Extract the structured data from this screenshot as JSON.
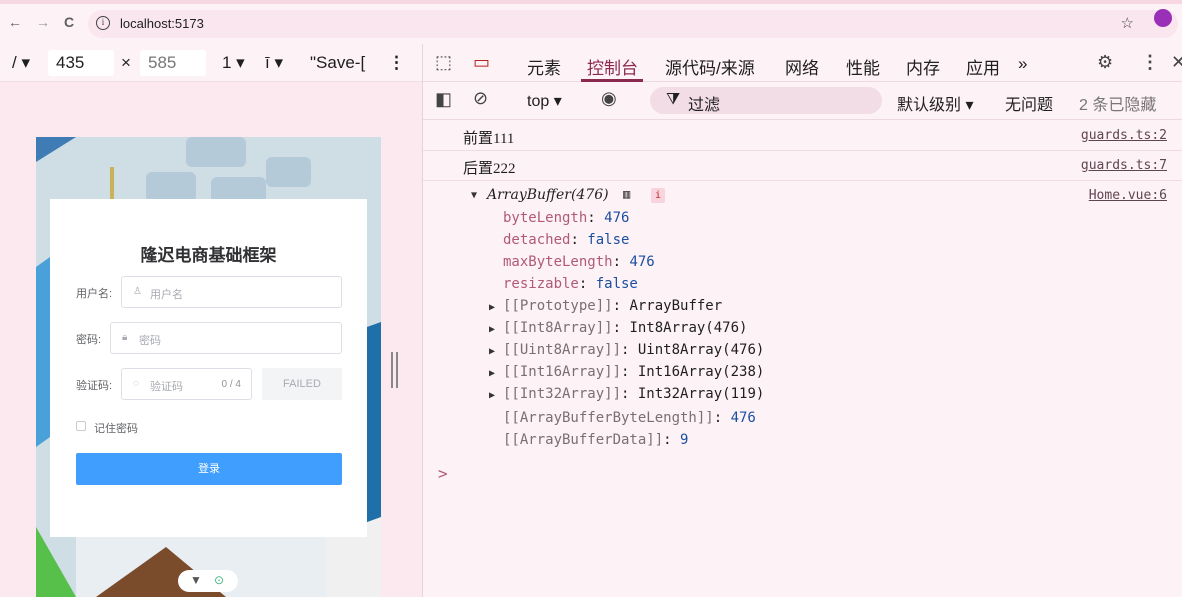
{
  "browser": {
    "url": "localhost:5173",
    "nav": {
      "back": "←",
      "forward": "→",
      "reload": "C"
    }
  },
  "device_toolbar": {
    "device_label": "/ ▾",
    "width": "435",
    "times": "×",
    "height": "585",
    "zoom": "1 ▾",
    "throttle": "ī ▾",
    "save": "\"Save-[",
    "more": "⋮"
  },
  "app": {
    "title": "隆迟电商基础框架",
    "username_label": "用户名:",
    "username_placeholder": "用户名",
    "password_label": "密码:",
    "password_placeholder": "密码",
    "captcha_label": "验证码:",
    "captcha_placeholder": "验证码",
    "captcha_count": "0 / 4",
    "captcha_image_text": "FAILED",
    "remember": "记住密码",
    "login": "登录"
  },
  "devtools": {
    "tabs": [
      "元素",
      "控制台",
      "源代码/来源",
      "网络",
      "性能",
      "内存",
      "应用"
    ],
    "active_tab": "控制台",
    "more_tabs": "»",
    "console_bar": {
      "context": "top ▾",
      "filter": "过滤",
      "level": "默认级别 ▾",
      "issues": "无问题",
      "hidden": "2 条已隐藏"
    },
    "logs": [
      {
        "msg": "前置111",
        "src": "guards.ts:2"
      },
      {
        "msg": "后置222",
        "src": "guards.ts:7"
      }
    ],
    "object": {
      "header": "ArrayBuffer(476)",
      "src": "Home.vue:6",
      "props": [
        {
          "key": "byteLength",
          "value": "476"
        },
        {
          "key": "detached",
          "value": "false"
        },
        {
          "key": "maxByteLength",
          "value": "476"
        },
        {
          "key": "resizable",
          "value": "false"
        }
      ],
      "expandable": [
        {
          "key": "[[Prototype]]",
          "value": "ArrayBuffer"
        },
        {
          "key": "[[Int8Array]]",
          "value": "Int8Array(476)"
        },
        {
          "key": "[[Uint8Array]]",
          "value": "Uint8Array(476)"
        },
        {
          "key": "[[Int16Array]]",
          "value": "Int16Array(238)"
        },
        {
          "key": "[[Int32Array]]",
          "value": "Int32Array(119)"
        }
      ],
      "internal": [
        {
          "key": "[[ArrayBufferByteLength]]",
          "value": "476"
        },
        {
          "key": "[[ArrayBufferData]]",
          "value": "9"
        }
      ]
    },
    "prompt": ">"
  },
  "colors": {
    "accent": "#8a2a4f",
    "login_button": "#409eff",
    "background": "#fdf2f6"
  }
}
